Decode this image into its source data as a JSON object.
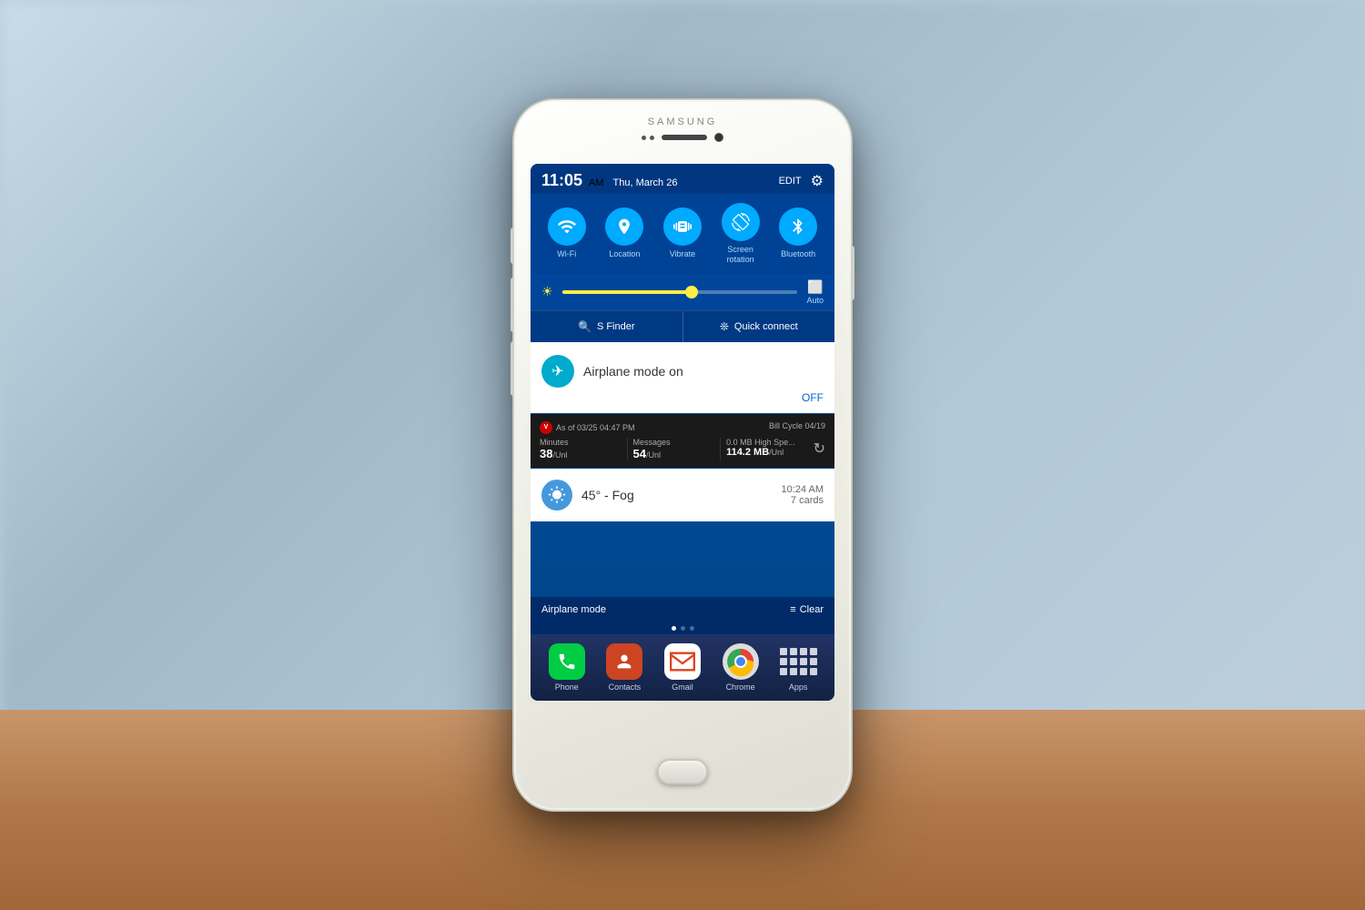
{
  "background": {
    "description": "blurred office interior background with wooden table"
  },
  "phone": {
    "brand": "SAMSUNG",
    "status_bar": {
      "time": "11:05",
      "ampm": "AM",
      "date": "Thu, March 26",
      "edit_label": "EDIT",
      "settings_icon": "⚙"
    },
    "quick_toggles": [
      {
        "id": "wifi",
        "label": "Wi-Fi",
        "icon": "📶",
        "active": true
      },
      {
        "id": "location",
        "label": "Location",
        "icon": "📍",
        "active": true
      },
      {
        "id": "vibrate",
        "label": "Vibrate",
        "icon": "📳",
        "active": true
      },
      {
        "id": "screen_rotation",
        "label": "Screen\nrotation",
        "icon": "🔄",
        "active": true
      },
      {
        "id": "bluetooth",
        "label": "Bluetooth",
        "icon": "🔵",
        "active": true
      }
    ],
    "brightness": {
      "icon": "☀",
      "value": 55,
      "auto_label": "Auto"
    },
    "finder_row": {
      "sfinder_icon": "🔍",
      "sfinder_label": "S Finder",
      "quickconnect_icon": "❄",
      "quickconnect_label": "Quick connect"
    },
    "notifications": {
      "airplane_card": {
        "icon": "✈",
        "title": "Airplane mode on",
        "off_label": "OFF"
      },
      "bill_card": {
        "as_of": "As of 03/25 04:47 PM",
        "bill_cycle": "Bill Cycle 04/19",
        "minutes_label": "Minutes",
        "minutes_value": "38",
        "minutes_unit": "/Unl",
        "messages_label": "Messages",
        "messages_value": "54",
        "messages_unit": "/Unl",
        "data_label": "0.0 MB High Spe...",
        "data_value": "114.2 MB",
        "data_unit": "/Unl"
      },
      "weather_card": {
        "icon": "🌤",
        "temp": "45° - Fog",
        "time": "10:24 AM",
        "cards": "7 cards"
      }
    },
    "bottom_bar": {
      "airplane_label": "Airplane mode",
      "clear_icon": "≡",
      "clear_label": "Clear"
    },
    "dock": [
      {
        "id": "phone",
        "label": "Phone",
        "icon": "📞"
      },
      {
        "id": "contacts",
        "label": "Contacts",
        "icon": "👤"
      },
      {
        "id": "gmail",
        "label": "Gmail",
        "icon": "M"
      },
      {
        "id": "chrome",
        "label": "Chrome"
      },
      {
        "id": "apps",
        "label": "Apps"
      }
    ]
  }
}
